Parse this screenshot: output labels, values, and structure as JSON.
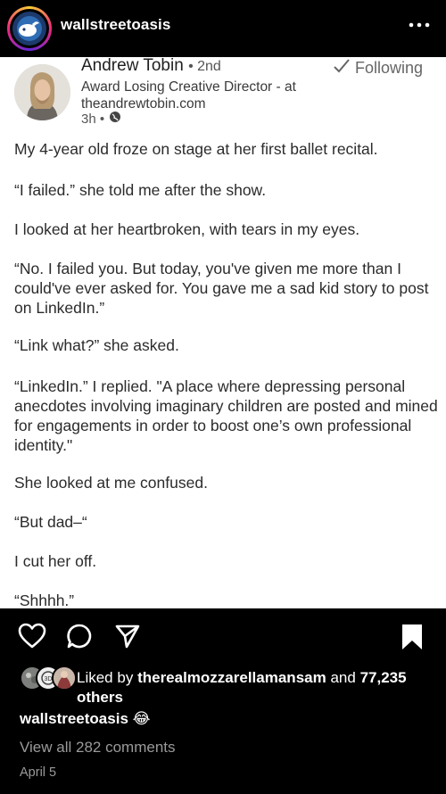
{
  "header": {
    "username": "wallstreetoasis",
    "avatar_icon": "wso-logo-icon",
    "more_icon": "more-dots-icon"
  },
  "post_image": {
    "author": {
      "name": "Andrew Tobin",
      "degree": "• 2nd",
      "headline_line1": "Award Losing Creative Director - at",
      "headline_line2": "theandrewtobin.com",
      "time": "3h •",
      "visibility_icon": "globe-icon",
      "follow_label": "Following",
      "follow_icon": "checkmark-icon"
    },
    "paragraphs": [
      "My 4-year old froze on stage at her first ballet recital.",
      "“I failed.” she told me after the show.",
      "I looked at her heartbroken, with tears in my eyes.",
      "“No. I failed you. But today, you've given me more than I could've ever asked for. You gave me a sad kid story to post on LinkedIn.”",
      "“Link what?” she asked.",
      "“LinkedIn.” I replied. \"A place where depressing personal anecdotes involving imaginary children are posted and mined for engagements in order to boost one’s own professional identity.\"",
      "She looked at me confused.",
      "“But dad–“",
      "I cut her off.",
      "“Shhhh.”"
    ]
  },
  "actions": {
    "like_icon": "heart-icon",
    "comment_icon": "comment-icon",
    "share_icon": "send-icon",
    "save_icon": "bookmark-icon"
  },
  "likes": {
    "prefix": "Liked by",
    "user": "therealmozzarellamansam",
    "conjunction": "and",
    "others": "77,235 others"
  },
  "caption": {
    "username": "wallstreetoasis",
    "emoji": "😂"
  },
  "comments": {
    "view_all": "View all 282 comments"
  },
  "date": "April 5",
  "colors": {
    "background": "#000000",
    "card": "#ffffff",
    "muted": "#9a9a9a"
  }
}
